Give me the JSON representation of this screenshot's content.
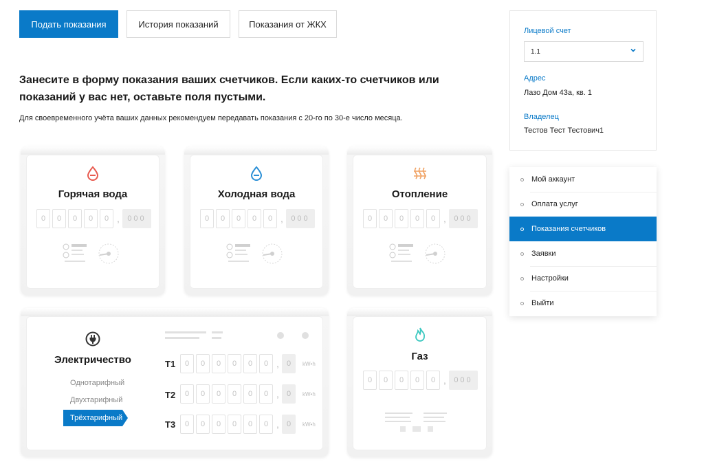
{
  "tabs": [
    {
      "label": "Подать показания",
      "active": true
    },
    {
      "label": "История показаний",
      "active": false
    },
    {
      "label": "Показания от ЖКХ",
      "active": false
    }
  ],
  "headline": "Занесите в форму показания ваших счетчиков. Если каких-то счетчиков или показаний у вас нет, оставьте поля пустыми.",
  "subline": "Для своевременного учёта ваших данных рекомендуем передавать показания с 20-го по 30-е число месяца.",
  "digit_placeholder": "0",
  "frac_placeholder": "000",
  "frac1_placeholder": "0",
  "comma": ",",
  "meters": {
    "hot_water": {
      "title": "Горячая вода",
      "icon": "hot-water-drop-icon",
      "color": "#e85a4f"
    },
    "cold_water": {
      "title": "Холодная вода",
      "icon": "cold-water-drop-icon",
      "color": "#2b8fd6"
    },
    "heating": {
      "title": "Отопление",
      "icon": "heating-icon",
      "color": "#f0a060"
    },
    "electricity": {
      "title": "Электричество",
      "icon": "plug-icon",
      "tariffs": [
        "Однотарифный",
        "Двухтарифный",
        "Трёхтарифный"
      ],
      "selected_tariff": "Трёхтарифный",
      "rows": [
        {
          "label": "T1"
        },
        {
          "label": "T2"
        },
        {
          "label": "T3"
        }
      ],
      "unit": "kW•h"
    },
    "gas": {
      "title": "Газ",
      "icon": "gas-flame-icon",
      "color": "#3cc8c0"
    }
  },
  "account": {
    "label": "Лицевой счет",
    "selected": "1.1",
    "address_label": "Адрес",
    "address": "Лазо Дом 43а, кв. 1",
    "owner_label": "Владелец",
    "owner": "Тестов Тест Тестович1"
  },
  "menu": [
    {
      "label": "Мой аккаунт",
      "active": false
    },
    {
      "label": "Оплата услуг",
      "active": false
    },
    {
      "label": "Показания счетчиков",
      "active": true
    },
    {
      "label": "Заявки",
      "active": false
    },
    {
      "label": "Настройки",
      "active": false
    },
    {
      "label": "Выйти",
      "active": false
    }
  ],
  "colors": {
    "accent": "#0a7ac8"
  }
}
